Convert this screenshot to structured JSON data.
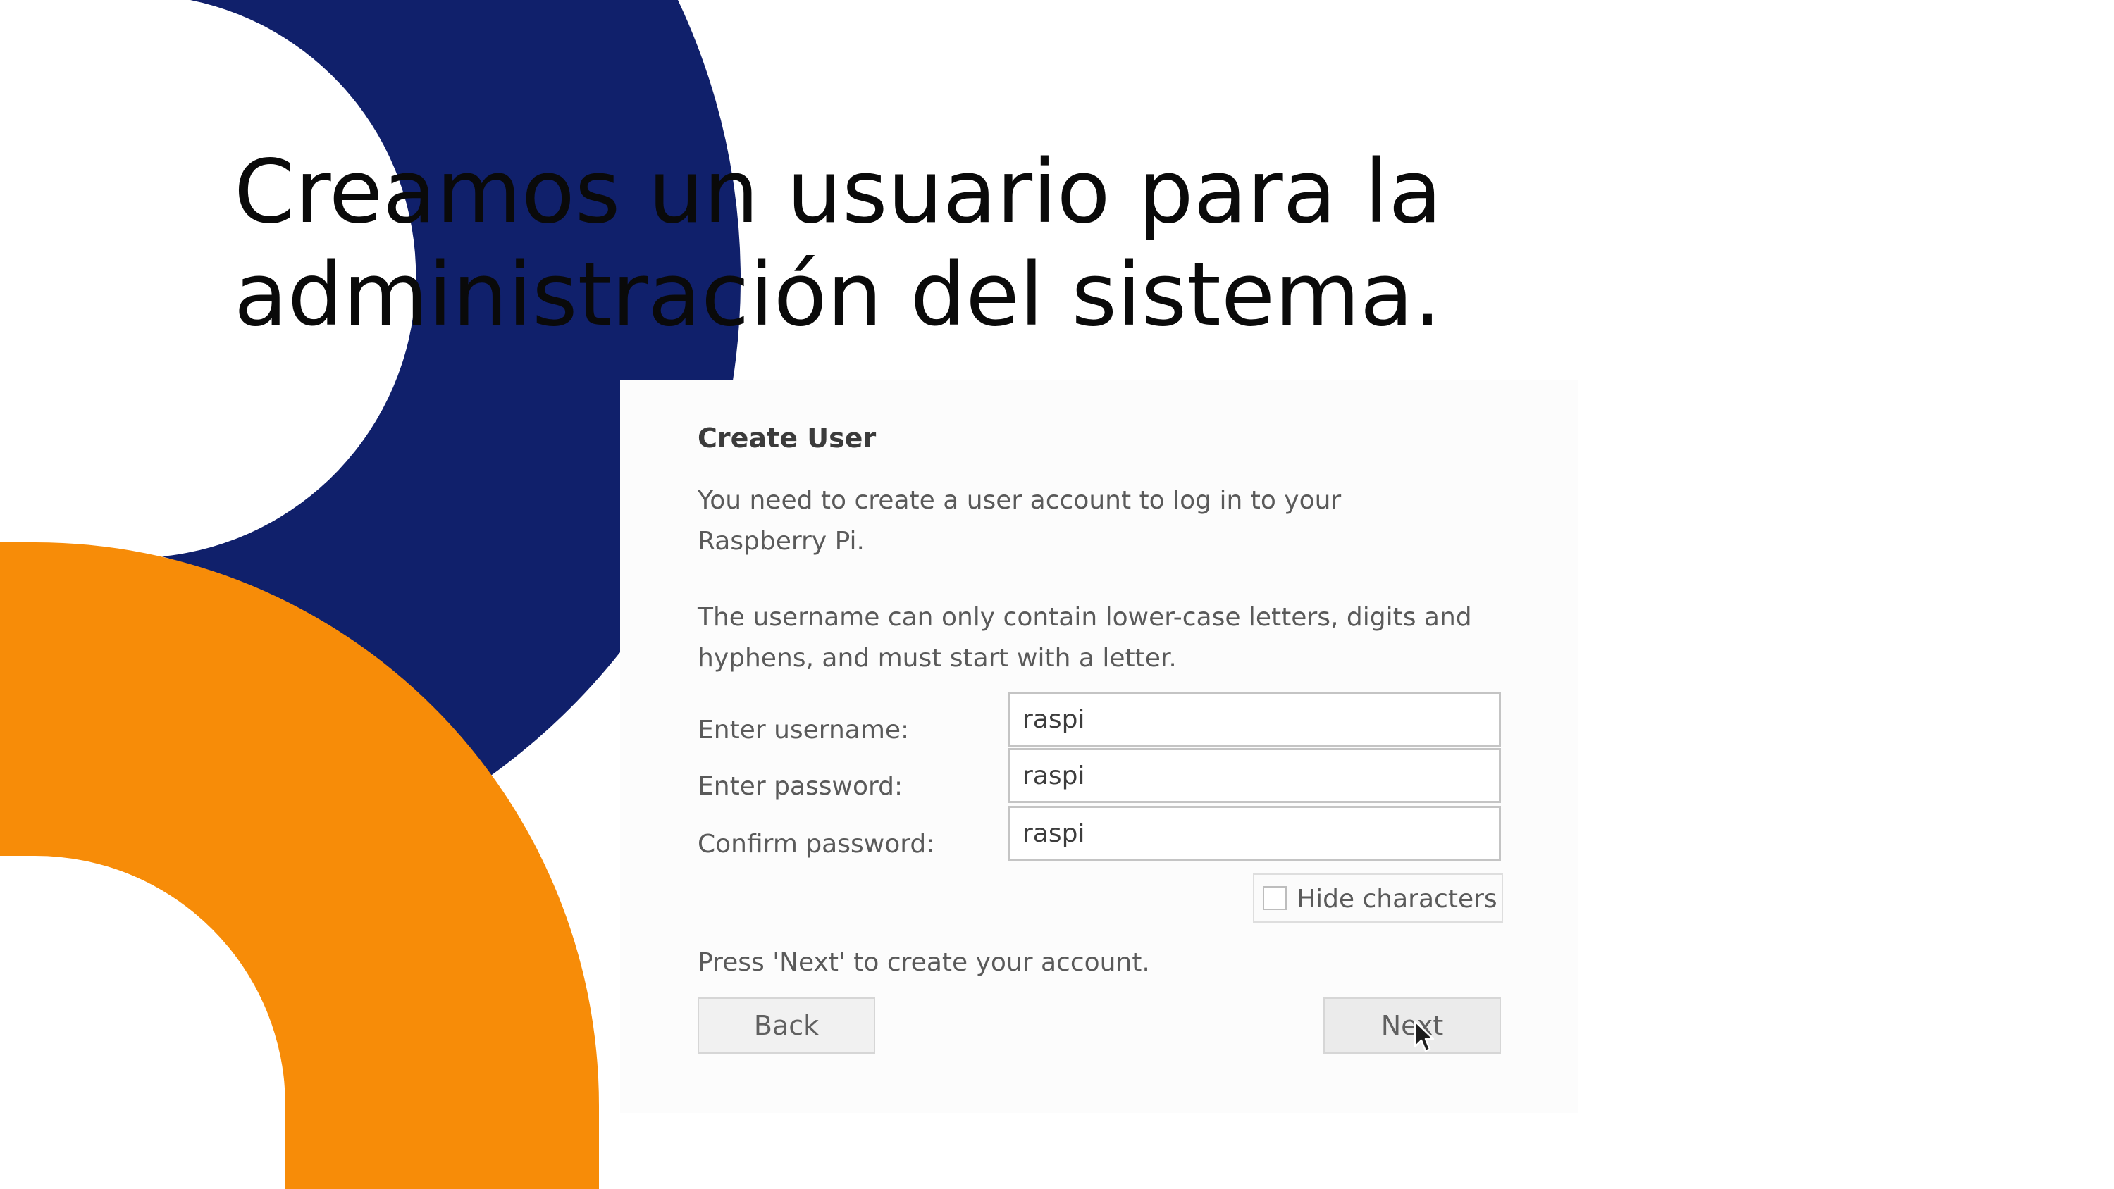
{
  "slide": {
    "title": "Creamos un usuario para la administración del sistema.",
    "colors": {
      "navy": "#10206b",
      "orange": "#f78c08",
      "background": "#ffffff"
    }
  },
  "dialog": {
    "title": "Create User",
    "intro": "You need to create a user account to log in to your Raspberry Pi.",
    "rules": "The username can only contain lower-case letters, digits and hyphens, and must start with a letter.",
    "username": {
      "label": "Enter username:",
      "value": "raspi"
    },
    "password": {
      "label": "Enter password:",
      "value": "raspi"
    },
    "confirm": {
      "label": "Confirm password:",
      "value": "raspi"
    },
    "hide_characters": {
      "label": "Hide characters",
      "checked": false
    },
    "hint": "Press 'Next' to create your account.",
    "back_label": "Back",
    "next_label": "Next"
  },
  "icons": {
    "pointer": "mouse-pointer-icon"
  }
}
